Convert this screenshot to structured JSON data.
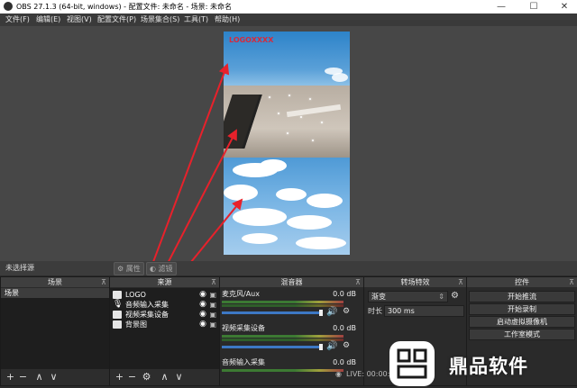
{
  "window": {
    "title": "OBS 27.1.3 (64-bit, windows) - 配置文件: 未命名 - 场景: 未命名",
    "minimize_label": "—",
    "maximize_label": "☐",
    "close_label": "✕"
  },
  "menu": {
    "items": [
      "文件(F)",
      "编辑(E)",
      "视图(V)",
      "配置文件(P)",
      "场景集合(S)",
      "工具(T)",
      "帮助(H)"
    ]
  },
  "preview": {
    "logo_text": "LOGOXXXX"
  },
  "status_row": {
    "no_source": "未选择源",
    "properties_label": "属性",
    "filters_label": "滤镜"
  },
  "scenes": {
    "header": "场景",
    "items": [
      "场景"
    ]
  },
  "sources": {
    "header": "来源",
    "items": [
      "LOGO",
      "音频输入采集",
      "视频采集设备",
      "背景图"
    ]
  },
  "mixer": {
    "header": "混音器",
    "channels": [
      {
        "name": "麦克风/Aux",
        "db": "0.0 dB"
      },
      {
        "name": "视频采集设备",
        "db": "0.0 dB"
      },
      {
        "name": "音频输入采集",
        "db": "0.0 dB"
      }
    ]
  },
  "transitions": {
    "header": "转场特效",
    "selected": "渐变",
    "duration_label": "时长",
    "duration_value": "300 ms"
  },
  "controls": {
    "header": "控件",
    "buttons": [
      "开始推流",
      "开始录制",
      "启动虚拟摄像机",
      "工作室模式"
    ]
  },
  "statusbar": {
    "live_text": "LIVE: 00:00:00"
  },
  "watermark": {
    "text": "鼎品软件"
  },
  "colors": {
    "arrow": "#e8212b",
    "accent_blue": "#3d78c4"
  },
  "icons": {
    "add": "+",
    "remove": "−",
    "up": "∧",
    "down": "∨",
    "gear": "⚙",
    "pin": "⊼",
    "eye": "👁",
    "lock": "🔒",
    "speaker": "🔊"
  }
}
